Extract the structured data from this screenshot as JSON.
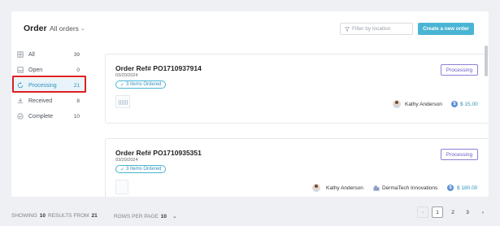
{
  "header": {
    "title": "Order",
    "filter_label": "All orders",
    "location_placeholder": "Filter by location",
    "create_button": "Create a new order"
  },
  "sidebar": {
    "items": [
      {
        "label": "All",
        "count": "39",
        "icon": "grid-icon"
      },
      {
        "label": "Open",
        "count": "0",
        "icon": "inbox-icon"
      },
      {
        "label": "Processing",
        "count": "21",
        "icon": "refresh-icon",
        "active": true
      },
      {
        "label": "Received",
        "count": "8",
        "icon": "download-icon"
      },
      {
        "label": "Complete",
        "count": "10",
        "icon": "check-circle-icon"
      }
    ]
  },
  "orders": [
    {
      "ref": "Order Ref# PO1710937914",
      "date": "03/20/2024",
      "items": "3 Items Ordered",
      "status": "Processing",
      "person": "Kathy Anderson",
      "amount": "$ 15.00"
    },
    {
      "ref": "Order Ref# PO1710935351",
      "date": "03/20/2024",
      "items": "3 Items Ordered",
      "status": "Processing",
      "person": "Kathy Anderson",
      "location": "DermaTech Innovations",
      "amount": "$ 180.00"
    }
  ],
  "footer": {
    "showing_prefix": "SHOWING",
    "showing_count": "10",
    "showing_mid": "RESULTS FROM",
    "showing_total": "21",
    "rpp_label": "ROWS PER PAGE",
    "rpp_value": "10",
    "pages": [
      "1",
      "2",
      "3"
    ],
    "prev": "‹",
    "next": "›"
  },
  "colors": {
    "accent": "#4ab4d4",
    "status": "#6b5bc4",
    "highlight": "#e02020"
  }
}
